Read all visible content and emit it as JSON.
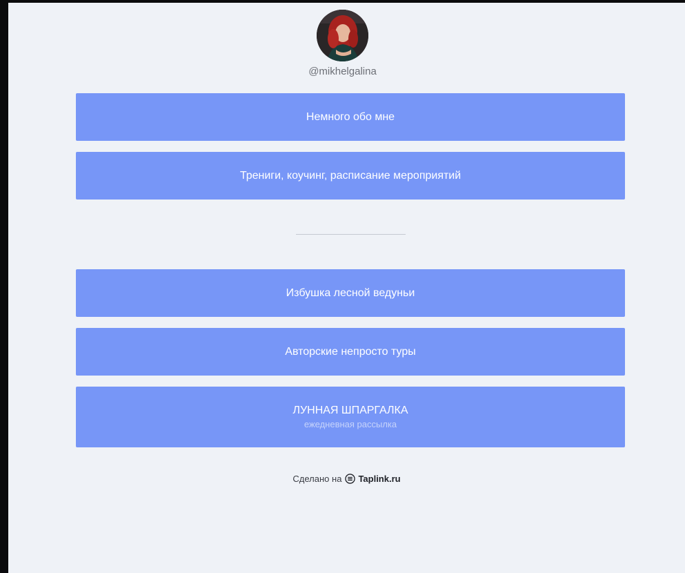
{
  "profile": {
    "username": "@mikhelgalina"
  },
  "links": [
    {
      "label": "Немного обо мне"
    },
    {
      "label": "Трениги, коучинг, расписание мероприятий"
    },
    {
      "label": "Избушка лесной ведуньи"
    },
    {
      "label": "Авторские непросто туры"
    },
    {
      "label": "ЛУННАЯ ШПАРГАЛКА",
      "sublabel": "ежедневная рассылка"
    }
  ],
  "footer": {
    "made_on": "Сделано на",
    "brand": "Taplink.ru",
    "icon": "taplink-logo-icon"
  },
  "colors": {
    "button_bg": "#7796f7",
    "page_bg": "#eff2f7",
    "outer_bg": "#0b0b0d"
  }
}
